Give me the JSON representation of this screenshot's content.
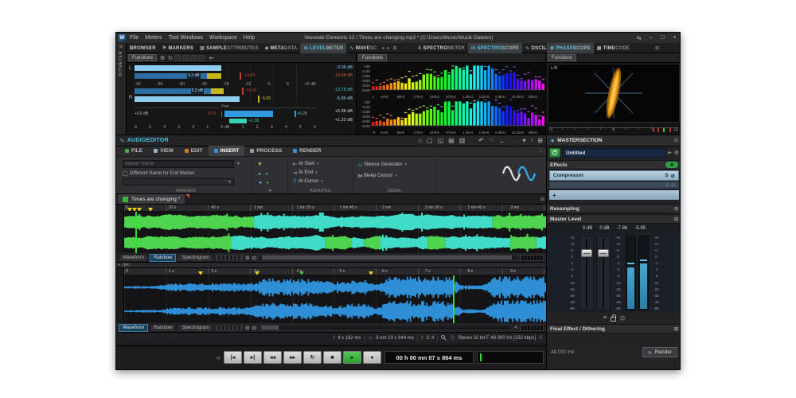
{
  "colors": {
    "accent": "#4fc1e0",
    "wave_cyan": "#40dcc8",
    "wave_green": "#4ed44e",
    "wave_blue": "#2e8fd6",
    "playhead": "#35e035",
    "meter_light": "#8ecdf0",
    "meter_dark": "#2e6da4",
    "meter_yellow": "#c3b61e",
    "peak_red": "#c0432e",
    "pan_blue": "#2f9be0",
    "pan_teal": "#35d4b0",
    "phase_orange": "#ee9d18"
  },
  "titlebar": {
    "logo": "W",
    "title": "Wavelab Elements 12 / Times are changing.mp3 * (C:\\Users\\Music\\Musik Dateien)",
    "menus": [
      "File",
      "Meters",
      "Tool Windows",
      "Workspace",
      "Help"
    ]
  },
  "left_strip": {
    "label": "BITMETER"
  },
  "meter_tabs": [
    {
      "p1": "BROWSER",
      "p2": ""
    },
    {
      "p1": "MARKERS",
      "p2": ""
    },
    {
      "p1": "SAMPLE",
      "p2": "ATTRIBUTES"
    },
    {
      "p1": "META",
      "p2": "DATA"
    },
    {
      "p1": "LEVEL",
      "p2": "METER",
      "active": true
    },
    {
      "p1": "WAVE",
      "p2": "SC"
    }
  ],
  "spectro_tabs": [
    {
      "p1": "SPECTRO",
      "p2": "METER"
    },
    {
      "p1": "SPECTRO",
      "p2": "SCOPE",
      "active": true
    },
    {
      "p1": "OSCILLO",
      "p2": "SCOPE"
    }
  ],
  "phase_tabs": [
    {
      "p1": "PHASE",
      "p2": "SCOPE",
      "active": true
    },
    {
      "p1": "TIME",
      "p2": "CODE"
    }
  ],
  "levelmeter": {
    "functions": "Functions",
    "ch_l": "L",
    "ch_r": "R",
    "scale": [
      "-42",
      "-36",
      "-30",
      "-24",
      "-18",
      "-12",
      "-6",
      "0",
      "+6 dB"
    ],
    "l_peak_value": "-3.06 dB",
    "l_rms_value": "-14.58 dB",
    "r_rms_value": "-13.78 dB",
    "r_peak_value": "-5.85 dB",
    "l_bar_tag": "5.3 dB",
    "r_bar_tag": "5.2 dB",
    "l_peak_tick": "-14.64",
    "r_peak_tick": "-14.09",
    "r_hold_tick": "-5.06",
    "pan": {
      "label": "Pan",
      "left_value": "+0.5 dB",
      "cursor_value": "-0.25",
      "hold_value": "+5.28",
      "top_value": "+5.38 dB",
      "inline_value": "+1.08",
      "bottom_value": "+1.22 dB",
      "scale": [
        "6",
        "5",
        "4",
        "3",
        "2",
        "1",
        "0 dB",
        "1",
        "2",
        "3",
        "4",
        "5",
        "6"
      ]
    }
  },
  "spectroscope": {
    "functions": "Functions",
    "db_labels": [
      "0dB",
      "-12dB",
      "-24dB",
      "-36dB",
      "-48dB",
      "-60dB"
    ],
    "freq_labels": [
      "44Hz",
      "86Hz",
      "170Hz",
      "340Hz",
      "670Hz",
      "1.3kHz",
      "2.6kHz",
      "5.3kHz",
      "10.1kHz",
      "20kHz"
    ],
    "row_l": "L",
    "row_r": "R"
  },
  "phasescope": {
    "functions": "Functions",
    "mode": "L/R",
    "scale": [
      "-1",
      "0",
      "+1"
    ]
  },
  "editor": {
    "title": "AUDIOEDITOR",
    "tabs": [
      "FILE",
      "VIEW",
      "EDIT",
      "INSERT",
      "PROCESS",
      "RENDER"
    ],
    "active_tab": "INSERT",
    "marker_placeholder": "Marker Name",
    "end_marker_label": "Different Name for End Marker",
    "at_start": "At Start",
    "at_end": "At End",
    "at_cursor": "At Cursor",
    "silence": "Silence Generator",
    "bleep": "Bleep Censor",
    "grp_markers": "MARKERS",
    "grp_audiofile": "AUDIOFILE",
    "grp_signal": "SIGNAL",
    "doc_tab": "Times are changing *",
    "overview_ruler": [
      "0",
      "20 s",
      "40 s",
      "1 mn",
      "1 mn 20 s",
      "1 mn 40 s",
      "2 mn",
      "2 mn 20 s",
      "2 mn 40 s",
      "3 mn"
    ],
    "zoom_ruler": [
      "0",
      "1 s",
      "2 s",
      "3 s",
      "4 s",
      "5 s",
      "6 s",
      "7 s",
      "8 s",
      "9 s"
    ],
    "view_buttons": [
      "Waveform",
      "Rainbow",
      "Spectrogram"
    ],
    "zoom_handle": "1=",
    "status": {
      "cursor": "4 s 162 ms",
      "length": "3 mn 13 s 944 ms",
      "note": "C 4",
      "format": "Stereo 32 bit F 48 000 Hz [192 kbps]"
    }
  },
  "master": {
    "tab": "MASTERSECTION",
    "preset": "Untitled",
    "effects": "Effects",
    "slot1": "Compressor",
    "solo": "S",
    "add": "+",
    "resampling": "Resampling",
    "master_level": "Master Level",
    "values": [
      "0 dB",
      "0 dB",
      "-7.86",
      "-5.95"
    ],
    "fader_scale": [
      "+6",
      "+3",
      "+1",
      "0",
      "-1",
      "-3",
      "-6",
      "-12",
      "-24",
      "-36",
      "-48",
      "-96"
    ],
    "final": "Final Effect / Dithering",
    "samplerate": "48 000 Hz",
    "render": "Render"
  },
  "transport": {
    "time": "00 h 00 mn 07 s 864 ms"
  }
}
